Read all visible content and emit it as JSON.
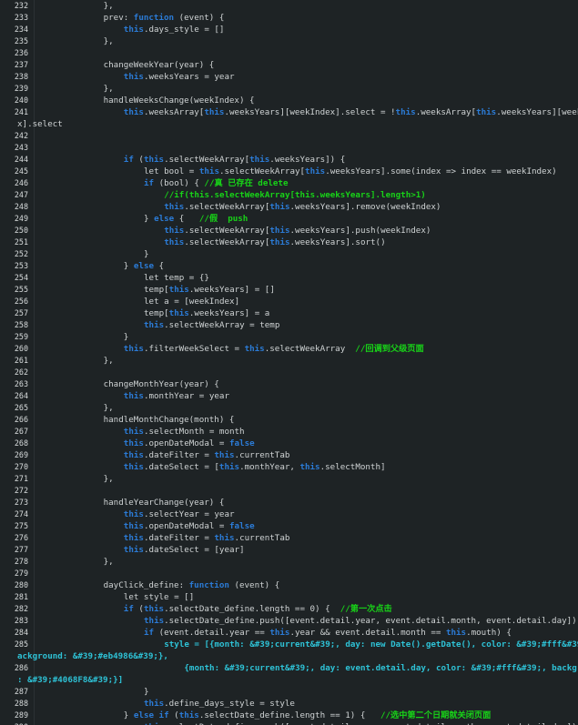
{
  "editor": {
    "lines": [
      {
        "n": "232",
        "indent": 12,
        "segs": [
          [
            "p",
            "},"
          ]
        ]
      },
      {
        "n": "233",
        "indent": 12,
        "segs": [
          [
            "p",
            "prev: "
          ],
          [
            "k",
            "function"
          ],
          [
            "p",
            " (event) {"
          ]
        ]
      },
      {
        "n": "234",
        "indent": 16,
        "segs": [
          [
            "k",
            "this"
          ],
          [
            "p",
            ".days_style = []"
          ]
        ]
      },
      {
        "n": "235",
        "indent": 12,
        "segs": [
          [
            "p",
            "},"
          ]
        ]
      },
      {
        "n": "236",
        "indent": 0,
        "segs": []
      },
      {
        "n": "237",
        "indent": 12,
        "segs": [
          [
            "p",
            "changeWeekYear(year) {"
          ]
        ]
      },
      {
        "n": "238",
        "indent": 16,
        "segs": [
          [
            "k",
            "this"
          ],
          [
            "p",
            ".weeksYears = year"
          ]
        ]
      },
      {
        "n": "239",
        "indent": 12,
        "segs": [
          [
            "p",
            "},"
          ]
        ]
      },
      {
        "n": "240",
        "indent": 12,
        "segs": [
          [
            "p",
            "handleWeeksChange(weekIndex) {"
          ]
        ]
      },
      {
        "n": "241",
        "indent": 16,
        "segs": [
          [
            "k",
            "this"
          ],
          [
            "p",
            ".weeksArray["
          ],
          [
            "k",
            "this"
          ],
          [
            "p",
            ".weeksYears][weekIndex].select = !"
          ],
          [
            "k",
            "this"
          ],
          [
            "p",
            ".weeksArray["
          ],
          [
            "k",
            "this"
          ],
          [
            "p",
            ".weeksYears][weekInde"
          ]
        ]
      },
      {
        "n": "",
        "indent": 0,
        "cont": true,
        "segs": [
          [
            "p",
            "x].select"
          ]
        ]
      },
      {
        "n": "242",
        "indent": 0,
        "segs": []
      },
      {
        "n": "243",
        "indent": 0,
        "segs": []
      },
      {
        "n": "244",
        "indent": 16,
        "segs": [
          [
            "k",
            "if"
          ],
          [
            "p",
            " ("
          ],
          [
            "k",
            "this"
          ],
          [
            "p",
            ".selectWeekArray["
          ],
          [
            "k",
            "this"
          ],
          [
            "p",
            ".weeksYears]) {"
          ]
        ]
      },
      {
        "n": "245",
        "indent": 20,
        "segs": [
          [
            "p",
            "let bool = "
          ],
          [
            "k",
            "this"
          ],
          [
            "p",
            ".selectWeekArray["
          ],
          [
            "k",
            "this"
          ],
          [
            "p",
            ".weeksYears].some(index => index == weekIndex)"
          ]
        ]
      },
      {
        "n": "246",
        "indent": 20,
        "segs": [
          [
            "k",
            "if"
          ],
          [
            "p",
            " (bool) { "
          ],
          [
            "c",
            "//真 已存在 delete"
          ]
        ]
      },
      {
        "n": "247",
        "indent": 24,
        "segs": [
          [
            "c",
            "//if(this.selectWeekArray[this.weeksYears].length>1)"
          ]
        ]
      },
      {
        "n": "248",
        "indent": 24,
        "segs": [
          [
            "k",
            "this"
          ],
          [
            "p",
            ".selectWeekArray["
          ],
          [
            "k",
            "this"
          ],
          [
            "p",
            ".weeksYears].remove(weekIndex)"
          ]
        ]
      },
      {
        "n": "249",
        "indent": 20,
        "segs": [
          [
            "p",
            "} "
          ],
          [
            "k",
            "else"
          ],
          [
            "p",
            " {   "
          ],
          [
            "c",
            "//假  push"
          ]
        ]
      },
      {
        "n": "250",
        "indent": 24,
        "segs": [
          [
            "k",
            "this"
          ],
          [
            "p",
            ".selectWeekArray["
          ],
          [
            "k",
            "this"
          ],
          [
            "p",
            ".weeksYears].push(weekIndex)"
          ]
        ]
      },
      {
        "n": "251",
        "indent": 24,
        "segs": [
          [
            "k",
            "this"
          ],
          [
            "p",
            ".selectWeekArray["
          ],
          [
            "k",
            "this"
          ],
          [
            "p",
            ".weeksYears].sort()"
          ]
        ]
      },
      {
        "n": "252",
        "indent": 20,
        "segs": [
          [
            "p",
            "}"
          ]
        ]
      },
      {
        "n": "253",
        "indent": 16,
        "segs": [
          [
            "p",
            "} "
          ],
          [
            "k",
            "else"
          ],
          [
            "p",
            " {"
          ]
        ]
      },
      {
        "n": "254",
        "indent": 20,
        "segs": [
          [
            "p",
            "let temp = {}"
          ]
        ]
      },
      {
        "n": "255",
        "indent": 20,
        "segs": [
          [
            "p",
            "temp["
          ],
          [
            "k",
            "this"
          ],
          [
            "p",
            ".weeksYears] = []"
          ]
        ]
      },
      {
        "n": "256",
        "indent": 20,
        "segs": [
          [
            "p",
            "let a = [weekIndex]"
          ]
        ]
      },
      {
        "n": "257",
        "indent": 20,
        "segs": [
          [
            "p",
            "temp["
          ],
          [
            "k",
            "this"
          ],
          [
            "p",
            ".weeksYears] = a"
          ]
        ]
      },
      {
        "n": "258",
        "indent": 20,
        "segs": [
          [
            "k",
            "this"
          ],
          [
            "p",
            ".selectWeekArray = temp"
          ]
        ]
      },
      {
        "n": "259",
        "indent": 16,
        "segs": [
          [
            "p",
            "}"
          ]
        ]
      },
      {
        "n": "260",
        "indent": 16,
        "segs": [
          [
            "k",
            "this"
          ],
          [
            "p",
            ".filterWeekSelect = "
          ],
          [
            "k",
            "this"
          ],
          [
            "p",
            ".selectWeekArray  "
          ],
          [
            "c",
            "//回调到父级页面"
          ]
        ]
      },
      {
        "n": "261",
        "indent": 12,
        "segs": [
          [
            "p",
            "},"
          ]
        ]
      },
      {
        "n": "262",
        "indent": 0,
        "segs": []
      },
      {
        "n": "263",
        "indent": 12,
        "segs": [
          [
            "p",
            "changeMonthYear(year) {"
          ]
        ]
      },
      {
        "n": "264",
        "indent": 16,
        "segs": [
          [
            "k",
            "this"
          ],
          [
            "p",
            ".monthYear = year"
          ]
        ]
      },
      {
        "n": "265",
        "indent": 12,
        "segs": [
          [
            "p",
            "},"
          ]
        ]
      },
      {
        "n": "266",
        "indent": 12,
        "segs": [
          [
            "p",
            "handleMonthChange(month) {"
          ]
        ]
      },
      {
        "n": "267",
        "indent": 16,
        "segs": [
          [
            "k",
            "this"
          ],
          [
            "p",
            ".selectMonth = month"
          ]
        ]
      },
      {
        "n": "268",
        "indent": 16,
        "segs": [
          [
            "k",
            "this"
          ],
          [
            "p",
            ".openDateModal = "
          ],
          [
            "k",
            "false"
          ]
        ]
      },
      {
        "n": "269",
        "indent": 16,
        "segs": [
          [
            "k",
            "this"
          ],
          [
            "p",
            ".dateFilter = "
          ],
          [
            "k",
            "this"
          ],
          [
            "p",
            ".currentTab"
          ]
        ]
      },
      {
        "n": "270",
        "indent": 16,
        "segs": [
          [
            "k",
            "this"
          ],
          [
            "p",
            ".dateSelect = ["
          ],
          [
            "k",
            "this"
          ],
          [
            "p",
            ".monthYear, "
          ],
          [
            "k",
            "this"
          ],
          [
            "p",
            ".selectMonth]"
          ]
        ]
      },
      {
        "n": "271",
        "indent": 12,
        "segs": [
          [
            "p",
            "},"
          ]
        ]
      },
      {
        "n": "272",
        "indent": 0,
        "segs": []
      },
      {
        "n": "273",
        "indent": 12,
        "segs": [
          [
            "p",
            "handleYearChange(year) {"
          ]
        ]
      },
      {
        "n": "274",
        "indent": 16,
        "segs": [
          [
            "k",
            "this"
          ],
          [
            "p",
            ".selectYear = year"
          ]
        ]
      },
      {
        "n": "275",
        "indent": 16,
        "segs": [
          [
            "k",
            "this"
          ],
          [
            "p",
            ".openDateModal = "
          ],
          [
            "k",
            "false"
          ]
        ]
      },
      {
        "n": "276",
        "indent": 16,
        "segs": [
          [
            "k",
            "this"
          ],
          [
            "p",
            ".dateFilter = "
          ],
          [
            "k",
            "this"
          ],
          [
            "p",
            ".currentTab"
          ]
        ]
      },
      {
        "n": "277",
        "indent": 16,
        "segs": [
          [
            "k",
            "this"
          ],
          [
            "p",
            ".dateSelect = [year]"
          ]
        ]
      },
      {
        "n": "278",
        "indent": 12,
        "segs": [
          [
            "p",
            "},"
          ]
        ]
      },
      {
        "n": "279",
        "indent": 0,
        "segs": []
      },
      {
        "n": "280",
        "indent": 12,
        "segs": [
          [
            "p",
            "dayClick_define: "
          ],
          [
            "k",
            "function"
          ],
          [
            "p",
            " (event) {"
          ]
        ]
      },
      {
        "n": "281",
        "indent": 16,
        "segs": [
          [
            "p",
            "let style = []"
          ]
        ]
      },
      {
        "n": "282",
        "indent": 16,
        "segs": [
          [
            "k",
            "if"
          ],
          [
            "p",
            " ("
          ],
          [
            "k",
            "this"
          ],
          [
            "p",
            ".selectDate_define.length == 0) {  "
          ],
          [
            "c",
            "//第一次点击"
          ]
        ]
      },
      {
        "n": "283",
        "indent": 20,
        "segs": [
          [
            "k",
            "this"
          ],
          [
            "p",
            ".selectDate_define.push([event.detail.year, event.detail.month, event.detail.day])"
          ]
        ]
      },
      {
        "n": "284",
        "indent": 20,
        "segs": [
          [
            "k",
            "if"
          ],
          [
            "p",
            " (event.detail.year == "
          ],
          [
            "k",
            "this"
          ],
          [
            "p",
            ".year && event.detail.month == "
          ],
          [
            "k",
            "this"
          ],
          [
            "p",
            ".mouth) {"
          ]
        ]
      },
      {
        "n": "285",
        "indent": 24,
        "segs": [
          [
            "p",
            "style = [{month: &#39;current&#39;, day: new Date().getDate(), color: &#39;#fff&#39;, b"
          ]
        ],
        "style": "cy"
      },
      {
        "n": "",
        "indent": 0,
        "cont": true,
        "segs": [
          [
            "p",
            "ackground: &#39;#eb4986&#39;},"
          ]
        ],
        "style": "cy"
      },
      {
        "n": "286",
        "indent": 28,
        "segs": [
          [
            "p",
            "{month: &#39;current&#39;, day: event.detail.day, color: &#39;#fff&#39;, background"
          ]
        ],
        "style": "cy"
      },
      {
        "n": "",
        "indent": 0,
        "cont": true,
        "segs": [
          [
            "p",
            ": &#39;#4068F8&#39;}]"
          ]
        ],
        "style": "cy"
      },
      {
        "n": "287",
        "indent": 20,
        "segs": [
          [
            "p",
            "}"
          ]
        ]
      },
      {
        "n": "288",
        "indent": 20,
        "segs": [
          [
            "k",
            "this"
          ],
          [
            "p",
            ".define_days_style = style"
          ]
        ]
      },
      {
        "n": "289",
        "indent": 16,
        "segs": [
          [
            "p",
            "} "
          ],
          [
            "k",
            "else if"
          ],
          [
            "p",
            " ("
          ],
          [
            "k",
            "this"
          ],
          [
            "p",
            ".selectDate_define.length == 1) {   "
          ],
          [
            "c",
            "//选中第二个日期就关闭页面"
          ]
        ]
      },
      {
        "n": "290",
        "indent": 20,
        "segs": [
          [
            "k",
            "this"
          ],
          [
            "p",
            ".selectDate_define.push([event.detail.year, event.detail.month, event.detail.day])"
          ]
        ]
      },
      {
        "n": "291",
        "indent": 20,
        "segs": [
          [
            "k",
            "if"
          ],
          [
            "p",
            " (event.detail.year == "
          ],
          [
            "k",
            "this"
          ],
          [
            "p",
            ".year"
          ]
        ]
      }
    ]
  }
}
